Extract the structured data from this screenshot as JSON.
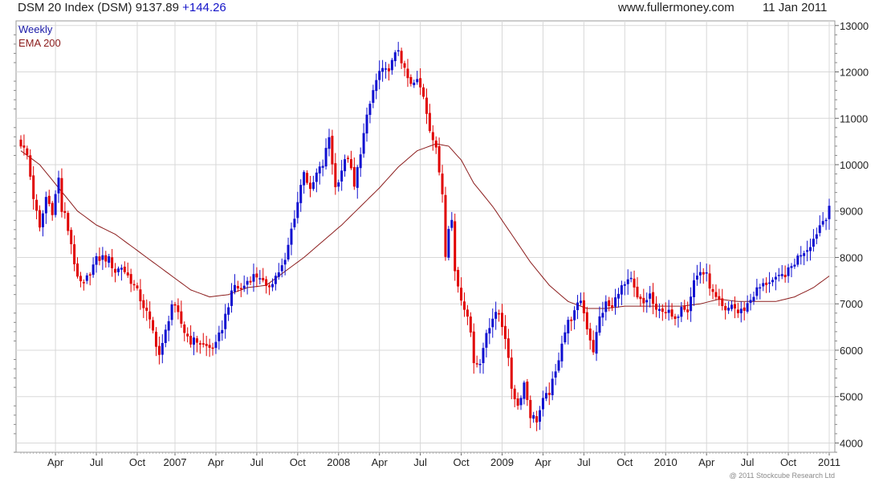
{
  "header": {
    "title": "DSM 20 Index (DSM) 9137.89",
    "change": "+144.26",
    "site": "www.fullermoney.com",
    "date": "11 Jan 2011"
  },
  "copyright": "@ 2011 Stockcube Research Ltd",
  "colors": {
    "up": "#1010d0",
    "down": "#e00000",
    "ema": "#8b1c1c",
    "grid": "#d8d8d8",
    "weekly_legend": "#1a1aa8"
  },
  "chart_data": {
    "type": "candlestick",
    "legend": [
      {
        "name": "Weekly",
        "color": "#1a1aa8"
      },
      {
        "name": "EMA 200",
        "color": "#8b1c1c"
      }
    ],
    "y_ticks": [
      "13000",
      "12000",
      "11000",
      "10000",
      "9000",
      "8000",
      "7000",
      "6000",
      "5000",
      "4000"
    ],
    "y_tick_values": [
      13000,
      12000,
      11000,
      10000,
      9000,
      8000,
      7000,
      6000,
      5000,
      4000
    ],
    "ylim": [
      3800,
      13100
    ],
    "x_ticks": [
      {
        "label": "Apr",
        "week": 11
      },
      {
        "label": "Jul",
        "week": 24
      },
      {
        "label": "Oct",
        "week": 37
      },
      {
        "label": "2007",
        "week": 49
      },
      {
        "label": "Apr",
        "week": 62
      },
      {
        "label": "Jul",
        "week": 75
      },
      {
        "label": "Oct",
        "week": 88
      },
      {
        "label": "2008",
        "week": 101
      },
      {
        "label": "Apr",
        "week": 114
      },
      {
        "label": "Jul",
        "week": 127
      },
      {
        "label": "Oct",
        "week": 140
      },
      {
        "label": "2009",
        "week": 153
      },
      {
        "label": "Apr",
        "week": 166
      },
      {
        "label": "Jul",
        "week": 179
      },
      {
        "label": "Oct",
        "week": 192
      },
      {
        "label": "2010",
        "week": 205
      },
      {
        "label": "Apr",
        "week": 218
      },
      {
        "label": "Jul",
        "week": 231
      },
      {
        "label": "Oct",
        "week": 244
      },
      {
        "label": "2011",
        "week": 257
      }
    ],
    "weeks_total": 258,
    "close_anchors": [
      [
        0,
        10450
      ],
      [
        2,
        10200
      ],
      [
        4,
        9300
      ],
      [
        6,
        8600
      ],
      [
        8,
        9300
      ],
      [
        10,
        9000
      ],
      [
        12,
        9700
      ],
      [
        13,
        9000
      ],
      [
        14,
        8900
      ],
      [
        16,
        8300
      ],
      [
        18,
        7500
      ],
      [
        20,
        7400
      ],
      [
        22,
        7700
      ],
      [
        24,
        7950
      ],
      [
        26,
        8000
      ],
      [
        28,
        7950
      ],
      [
        30,
        7700
      ],
      [
        32,
        7800
      ],
      [
        34,
        7600
      ],
      [
        36,
        7400
      ],
      [
        38,
        7100
      ],
      [
        40,
        6800
      ],
      [
        42,
        6400
      ],
      [
        44,
        5900
      ],
      [
        45,
        6100
      ],
      [
        47,
        6700
      ],
      [
        48,
        7000
      ],
      [
        50,
        6750
      ],
      [
        52,
        6400
      ],
      [
        54,
        6200
      ],
      [
        56,
        6200
      ],
      [
        58,
        6100
      ],
      [
        60,
        6050
      ],
      [
        62,
        6100
      ],
      [
        64,
        6500
      ],
      [
        66,
        7000
      ],
      [
        68,
        7400
      ],
      [
        70,
        7300
      ],
      [
        72,
        7500
      ],
      [
        74,
        7600
      ],
      [
        76,
        7600
      ],
      [
        78,
        7300
      ],
      [
        80,
        7500
      ],
      [
        82,
        7700
      ],
      [
        84,
        7900
      ],
      [
        86,
        8600
      ],
      [
        88,
        9200
      ],
      [
        90,
        9900
      ],
      [
        92,
        9400
      ],
      [
        94,
        9800
      ],
      [
        96,
        10000
      ],
      [
        98,
        10600
      ],
      [
        100,
        9500
      ],
      [
        102,
        9900
      ],
      [
        104,
        10200
      ],
      [
        106,
        9500
      ],
      [
        108,
        10300
      ],
      [
        110,
        11000
      ],
      [
        112,
        11600
      ],
      [
        114,
        12000
      ],
      [
        116,
        12000
      ],
      [
        118,
        12200
      ],
      [
        120,
        12500
      ],
      [
        122,
        12000
      ],
      [
        124,
        11700
      ],
      [
        126,
        11800
      ],
      [
        128,
        11500
      ],
      [
        130,
        10800
      ],
      [
        132,
        10300
      ],
      [
        134,
        9400
      ],
      [
        135,
        8100
      ],
      [
        136,
        8700
      ],
      [
        137,
        8800
      ],
      [
        138,
        7700
      ],
      [
        140,
        7100
      ],
      [
        142,
        6800
      ],
      [
        144,
        5800
      ],
      [
        146,
        5700
      ],
      [
        148,
        6400
      ],
      [
        150,
        6700
      ],
      [
        152,
        6800
      ],
      [
        154,
        6300
      ],
      [
        156,
        5200
      ],
      [
        158,
        4800
      ],
      [
        160,
        5300
      ],
      [
        162,
        4600
      ],
      [
        164,
        4500
      ],
      [
        166,
        4900
      ],
      [
        168,
        5100
      ],
      [
        170,
        5500
      ],
      [
        172,
        6200
      ],
      [
        174,
        6600
      ],
      [
        176,
        6800
      ],
      [
        178,
        7100
      ],
      [
        180,
        6500
      ],
      [
        182,
        6000
      ],
      [
        184,
        6700
      ],
      [
        186,
        7000
      ],
      [
        188,
        6900
      ],
      [
        190,
        7300
      ],
      [
        192,
        7400
      ],
      [
        194,
        7500
      ],
      [
        196,
        7100
      ],
      [
        198,
        7000
      ],
      [
        200,
        7200
      ],
      [
        202,
        6800
      ],
      [
        204,
        6900
      ],
      [
        206,
        6800
      ],
      [
        208,
        6600
      ],
      [
        210,
        7000
      ],
      [
        212,
        6900
      ],
      [
        214,
        7500
      ],
      [
        216,
        7700
      ],
      [
        218,
        7600
      ],
      [
        220,
        7200
      ],
      [
        222,
        7000
      ],
      [
        224,
        6800
      ],
      [
        226,
        7000
      ],
      [
        228,
        6800
      ],
      [
        230,
        6900
      ],
      [
        232,
        7100
      ],
      [
        234,
        7300
      ],
      [
        236,
        7400
      ],
      [
        238,
        7500
      ],
      [
        240,
        7500
      ],
      [
        242,
        7600
      ],
      [
        244,
        7700
      ],
      [
        246,
        7900
      ],
      [
        248,
        8100
      ],
      [
        250,
        8200
      ],
      [
        252,
        8400
      ],
      [
        254,
        8700
      ],
      [
        256,
        8900
      ],
      [
        257,
        9138
      ]
    ],
    "ema_anchors": [
      [
        0,
        10300
      ],
      [
        6,
        10000
      ],
      [
        12,
        9500
      ],
      [
        18,
        9000
      ],
      [
        24,
        8700
      ],
      [
        30,
        8500
      ],
      [
        36,
        8200
      ],
      [
        42,
        7900
      ],
      [
        48,
        7600
      ],
      [
        54,
        7300
      ],
      [
        60,
        7150
      ],
      [
        66,
        7200
      ],
      [
        72,
        7350
      ],
      [
        78,
        7400
      ],
      [
        84,
        7700
      ],
      [
        90,
        8000
      ],
      [
        96,
        8350
      ],
      [
        102,
        8700
      ],
      [
        108,
        9100
      ],
      [
        114,
        9500
      ],
      [
        120,
        9950
      ],
      [
        126,
        10300
      ],
      [
        132,
        10450
      ],
      [
        136,
        10400
      ],
      [
        140,
        10100
      ],
      [
        144,
        9600
      ],
      [
        150,
        9100
      ],
      [
        156,
        8500
      ],
      [
        162,
        7900
      ],
      [
        168,
        7400
      ],
      [
        174,
        7050
      ],
      [
        180,
        6900
      ],
      [
        186,
        6900
      ],
      [
        192,
        6950
      ],
      [
        198,
        6950
      ],
      [
        204,
        6950
      ],
      [
        210,
        6950
      ],
      [
        216,
        7000
      ],
      [
        222,
        7100
      ],
      [
        228,
        7050
      ],
      [
        234,
        7050
      ],
      [
        240,
        7050
      ],
      [
        246,
        7150
      ],
      [
        252,
        7350
      ],
      [
        257,
        7600
      ]
    ]
  }
}
